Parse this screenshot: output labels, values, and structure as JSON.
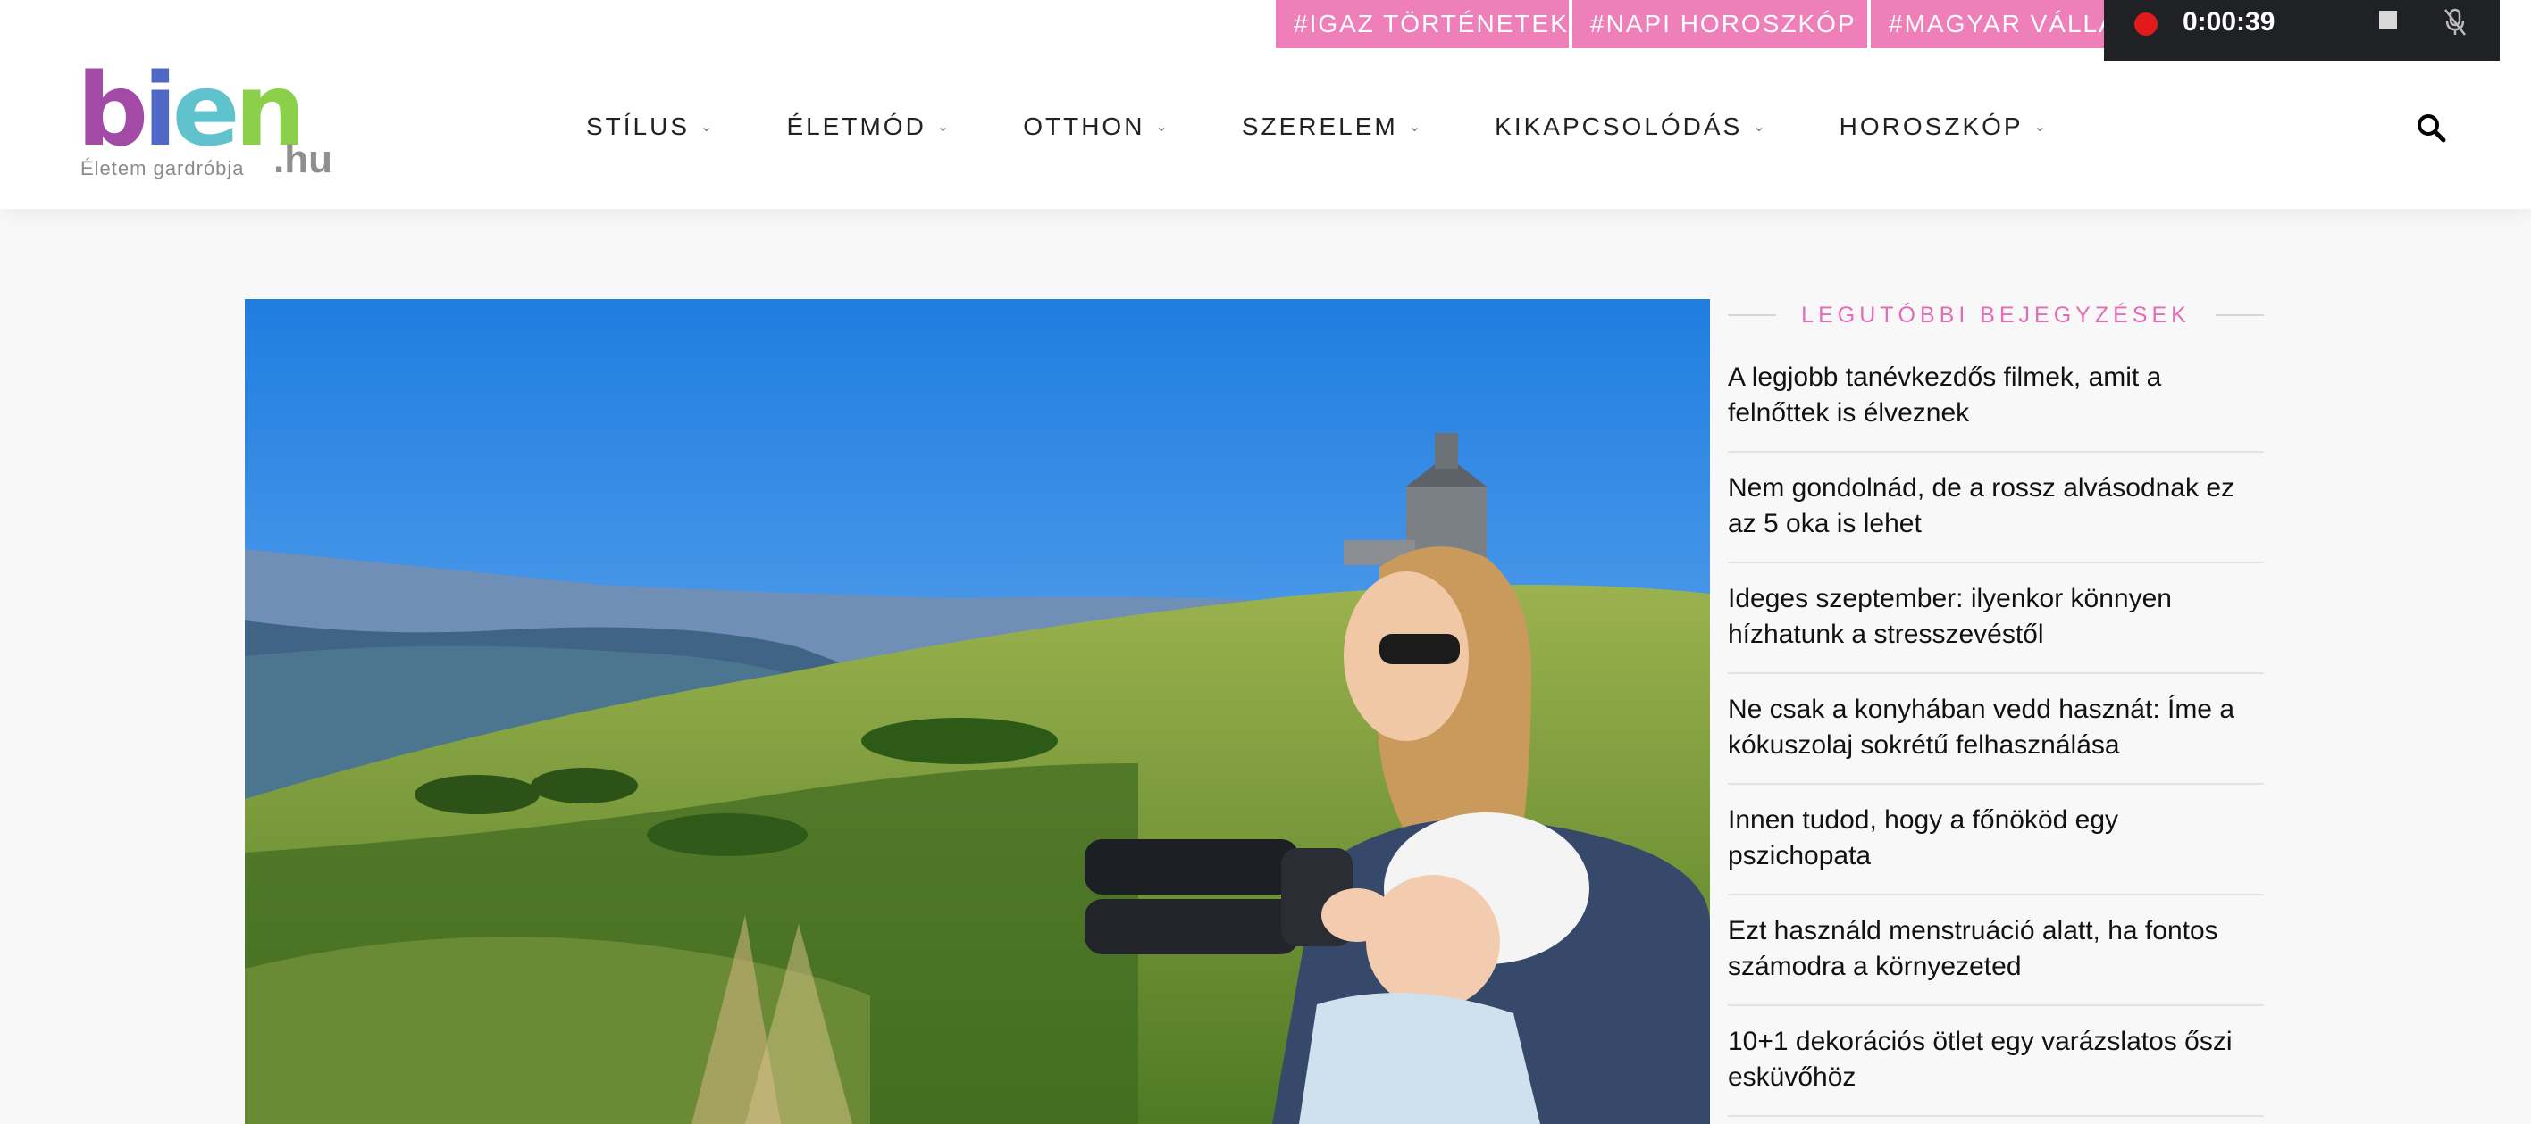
{
  "topbar": {
    "tags": [
      "#IGAZ TÖRTÉNETEK",
      "#NAPI HOROSZKÓP",
      "#MAGYAR VÁLLA"
    ]
  },
  "recorder": {
    "time": "0:00:39",
    "status_color": "#e11b1b"
  },
  "logo": {
    "wordmark": [
      "b",
      "i",
      "e",
      "n"
    ],
    "tld": ".hu",
    "tagline": "Életem gardróbja"
  },
  "nav": {
    "items": [
      {
        "label": "STÍLUS"
      },
      {
        "label": "ÉLETMÓD"
      },
      {
        "label": "OTTHON"
      },
      {
        "label": "SZERELEM"
      },
      {
        "label": "KIKAPCSOLÓDÁS"
      },
      {
        "label": "HOROSZKÓP"
      }
    ],
    "search_icon": "search-icon"
  },
  "sidebar": {
    "heading": "LEGUTÓBBI BEJEGYZÉSEK",
    "accent": "#e56cb3",
    "posts": [
      "A legjobb tanévkezdős filmek, amit a felnőttek is élveznek",
      "Nem gondolnád, de a rossz alvásodnak ez az 5 oka is lehet",
      "Ideges szeptember: ilyenkor könnyen hízhatunk a stresszevéstől",
      "Ne csak a konyhában vedd hasznát: Íme a kókuszolaj sokrétű felhasználása",
      "Innen tudod, hogy a főnököd egy pszichopata",
      "Ezt használd menstruáció alatt, ha fontos számodra a környezeted",
      "10+1 dekorációs ötlet egy varázslatos őszi esküvőhöz"
    ]
  },
  "colors": {
    "tag_bg": "#ef7fb8",
    "page_bg": "#f8f8f9"
  }
}
